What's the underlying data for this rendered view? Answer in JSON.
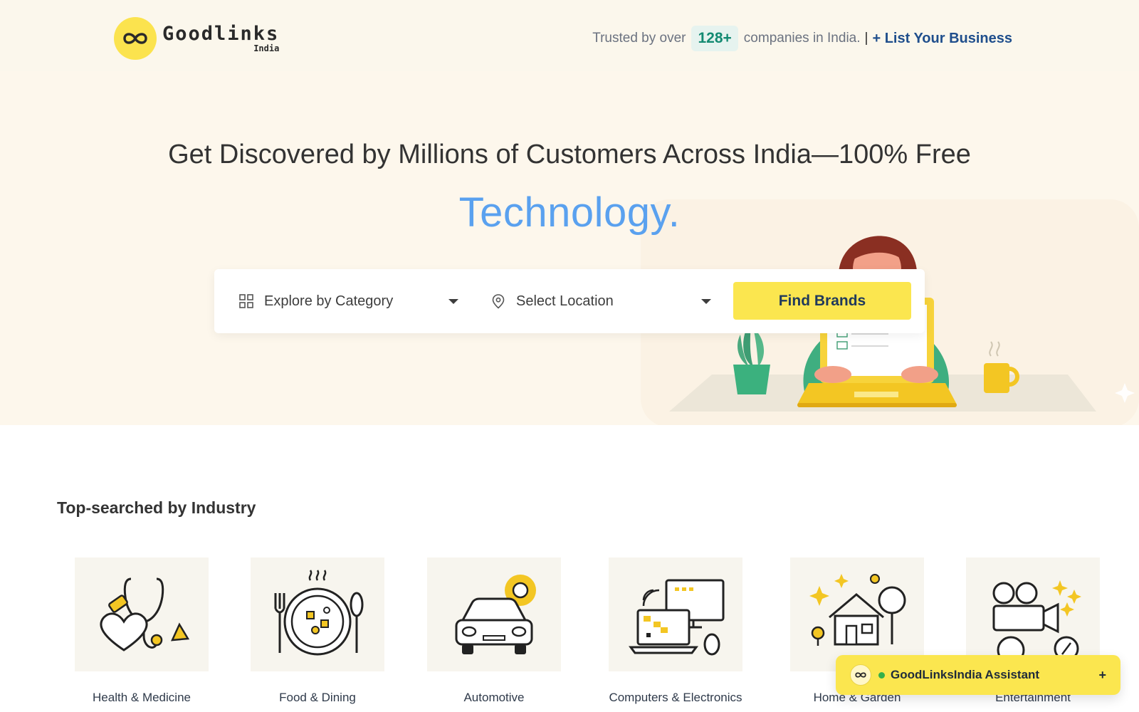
{
  "header": {
    "logo_name": "Goodlinks",
    "logo_sub": "India",
    "trust_prefix": "Trusted by over",
    "trust_count": "128+",
    "trust_suffix": "companies in India.",
    "separator": "|",
    "list_business": "+ List Your Business"
  },
  "hero": {
    "headline": "Get Discovered by Millions of Customers Across India—100% Free",
    "rotating_word": "Technology."
  },
  "search": {
    "category_label": "Explore by Category",
    "location_label": "Select Location",
    "button_label": "Find Brands"
  },
  "industries": {
    "title": "Top-searched by Industry",
    "items": [
      {
        "label": "Health & Medicine",
        "icon": "stethoscope-heart-icon"
      },
      {
        "label": "Food & Dining",
        "icon": "plate-fork-spoon-icon"
      },
      {
        "label": "Automotive",
        "icon": "car-gear-icon"
      },
      {
        "label": "Computers & Electronics",
        "icon": "laptop-monitor-icon"
      },
      {
        "label": "Home & Garden",
        "icon": "house-tree-icon"
      },
      {
        "label": "Entertainment",
        "icon": "movie-camera-icon"
      }
    ]
  },
  "assistant": {
    "name": "GoodLinksIndia Assistant",
    "expand": "+"
  },
  "colors": {
    "brand_yellow": "#fbe64f",
    "accent_blue": "#5aa1ef",
    "link_blue": "#1f4e8c",
    "count_green": "#138a72"
  }
}
